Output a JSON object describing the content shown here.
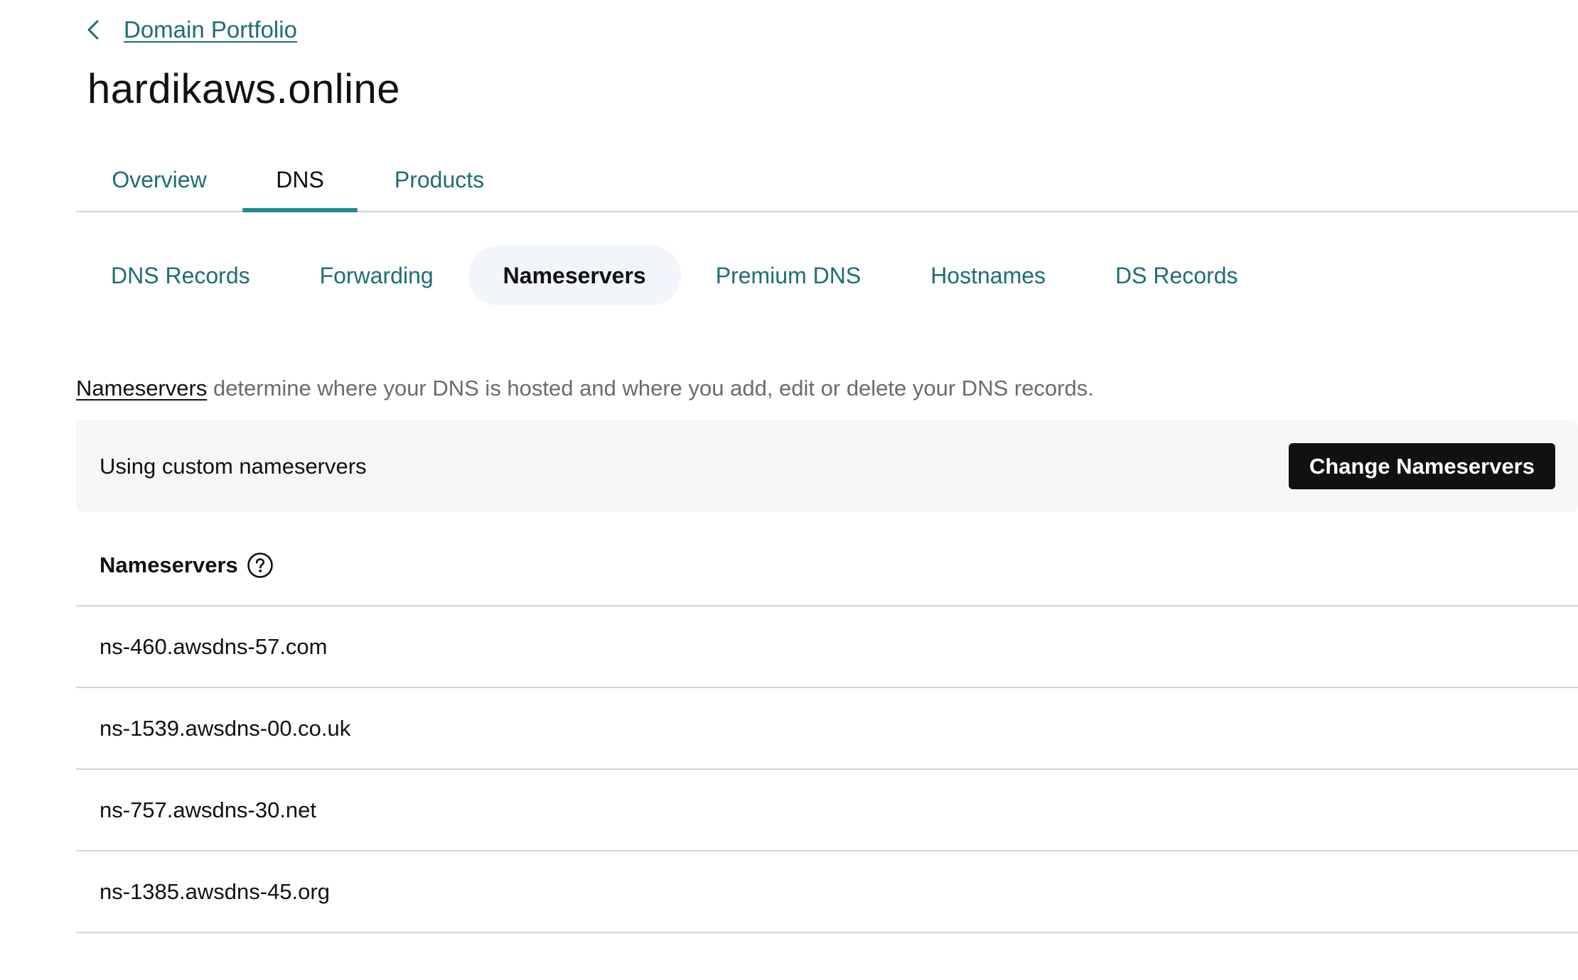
{
  "breadcrumb": {
    "back_icon": "chevron-left-icon",
    "link_label": "Domain Portfolio"
  },
  "page": {
    "title": "hardikaws.online"
  },
  "primary_tabs": [
    {
      "label": "Overview",
      "active": false
    },
    {
      "label": "DNS",
      "active": true
    },
    {
      "label": "Products",
      "active": false
    }
  ],
  "sub_tabs": [
    {
      "label": "DNS Records",
      "active": false
    },
    {
      "label": "Forwarding",
      "active": false
    },
    {
      "label": "Nameservers",
      "active": true
    },
    {
      "label": "Premium DNS",
      "active": false
    },
    {
      "label": "Hostnames",
      "active": false
    },
    {
      "label": "DS Records",
      "active": false
    }
  ],
  "description": {
    "link_text": "Nameservers",
    "text": " determine where your DNS is hosted and where you add, edit or delete your DNS records."
  },
  "status_panel": {
    "text": "Using custom nameservers",
    "button_label": "Change Nameservers"
  },
  "nameservers": {
    "header_label": "Nameservers",
    "help_icon": "question-circle-icon",
    "rows": [
      "ns-460.awsdns-57.com",
      "ns-1539.awsdns-00.co.uk",
      "ns-757.awsdns-30.net",
      "ns-1385.awsdns-45.org"
    ]
  },
  "colors": {
    "link_teal": "#1b6f74",
    "tab_underline": "#1f8a91",
    "panel_bg": "#f4f6f8",
    "pill_active_bg": "#f2f5f9",
    "button_bg": "#111111",
    "divider": "#d4d4d4"
  }
}
